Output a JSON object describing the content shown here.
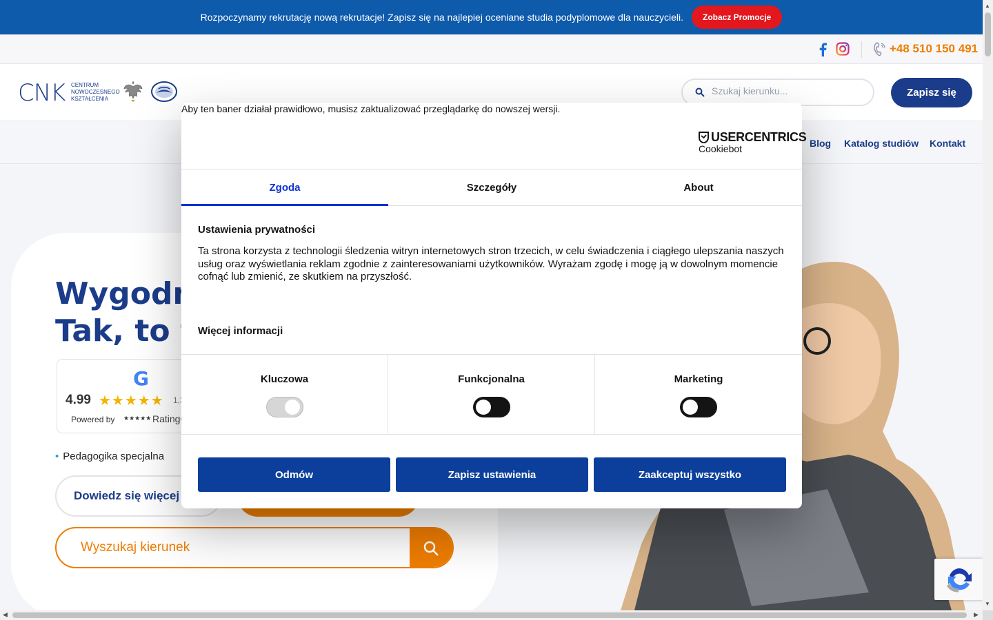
{
  "promo": {
    "text": "Rozpoczynamy rekrutację nową rekrutacje! Zapisz się na najlepiej oceniane studia podyplomowe dla nauczycieli.",
    "button": "Zobacz Promocje"
  },
  "utility": {
    "phone": "+48 510 150 491"
  },
  "header": {
    "logo_text": "CNK",
    "logo_sub": "CENTRUM NOWOCZESNEGO KSZTAŁCENIA",
    "search_placeholder": "Szukaj kierunku...",
    "signup_button": "Zapisz się"
  },
  "nav": {
    "items": [
      {
        "label": "Blog"
      },
      {
        "label": "Katalog studiów"
      },
      {
        "label": "Kontakt"
      }
    ]
  },
  "hero": {
    "title_line1": "Wygodn",
    "title_line2": "Tak, to tu",
    "rating": {
      "google_letter": "G",
      "value": "4.99",
      "stars": "★★★★★",
      "count": "1,3",
      "powered_label": "Powered by",
      "powered_stars": "★★★★★",
      "powered_brand": "RatingC"
    },
    "bullet": "Pedagogika specjalna",
    "more_button": "Dowiedz się więcej",
    "search_placeholder": "Wyszukaj kierunek"
  },
  "cookie": {
    "browser_warning": "Aby ten baner działał prawidłowo, musisz zaktualizować przeglądarkę do nowszej wersji.",
    "brand_name": "USERCENTRICS",
    "brand_sub": "Cookiebot",
    "tabs": [
      {
        "label": "Zgoda",
        "active": true
      },
      {
        "label": "Szczegóły"
      },
      {
        "label": "About"
      }
    ],
    "privacy_title": "Ustawienia prywatności",
    "privacy_body": "Ta strona korzysta z technologii śledzenia witryn internetowych stron trzecich, w celu świadczenia i ciągłego ulepszania naszych usług oraz wyświetlania reklam zgodnie z zainteresowaniami użytkowników. Wyrażam zgodę i mogę ją w dowolnym momencie cofnąć lub zmienić, ze skutkiem na przyszłość.",
    "more_info": "Więcej informacji",
    "categories": [
      {
        "label": "Kluczowa",
        "state": "on-disabled"
      },
      {
        "label": "Funkcjonalna",
        "state": "off"
      },
      {
        "label": "Marketing",
        "state": "off"
      }
    ],
    "buttons": {
      "deny": "Odmów",
      "save": "Zapisz ustawienia",
      "accept_all": "Zaakceptuj wszystko"
    }
  },
  "colors": {
    "primary_blue": "#1b3c8a",
    "promo_blue": "#0e5aab",
    "orange": "#ef7d00",
    "promo_red": "#e3171e",
    "cookie_button": "#0b3f9b"
  }
}
